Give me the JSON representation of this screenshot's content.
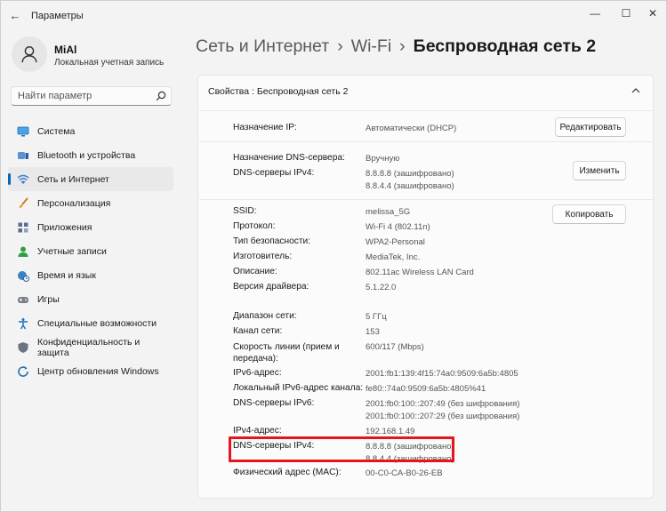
{
  "window": {
    "back_glyph": "←",
    "title": "Параметры",
    "minimize_glyph": "—",
    "maximize_glyph": "☐",
    "close_glyph": "✕"
  },
  "user": {
    "name": "MiAl",
    "account_type": "Локальная учетная запись"
  },
  "search": {
    "placeholder": "Найти параметр"
  },
  "sidebar": {
    "items": [
      {
        "label": "Система",
        "icon": "monitor-icon",
        "active": false
      },
      {
        "label": "Bluetooth и устройства",
        "icon": "bluetooth-devices-icon",
        "active": false
      },
      {
        "label": "Сеть и Интернет",
        "icon": "wifi-network-icon",
        "active": true
      },
      {
        "label": "Персонализация",
        "icon": "brush-icon",
        "active": false
      },
      {
        "label": "Приложения",
        "icon": "apps-icon",
        "active": false
      },
      {
        "label": "Учетные записи",
        "icon": "account-icon",
        "active": false
      },
      {
        "label": "Время и язык",
        "icon": "globe-clock-icon",
        "active": false
      },
      {
        "label": "Игры",
        "icon": "gamepad-icon",
        "active": false
      },
      {
        "label": "Специальные возможности",
        "icon": "accessibility-icon",
        "active": false
      },
      {
        "label": "Конфиденциальность и защита",
        "icon": "shield-icon",
        "active": false
      },
      {
        "label": "Центр обновления Windows",
        "icon": "update-icon",
        "active": false
      }
    ],
    "accent_color": "#0067c0"
  },
  "breadcrumb": {
    "items": [
      "Сеть и Интернет",
      "Wi-Fi"
    ],
    "separator": "›",
    "current": "Беспроводная сеть 2"
  },
  "panel": {
    "header": "Свойства : Беспроводная сеть 2",
    "ip_assignment": {
      "label": "Назначение IP:",
      "value": "Автоматически (DHCP)",
      "button": "Редактировать"
    },
    "dns_assignment": {
      "label": "Назначение DNS-сервера:",
      "value": "Вручную"
    },
    "dns_ipv4_top": {
      "label": "DNS-серверы IPv4:",
      "value1": "8.8.8.8 (зашифровано)",
      "value2": "8.8.4.4 (зашифровано)",
      "button": "Изменить"
    },
    "copy_button": "Копировать",
    "props": {
      "ssid": {
        "label": "SSID:",
        "value": "melissa_5G"
      },
      "protocol": {
        "label": "Протокол:",
        "value": "Wi-Fi 4 (802.11n)"
      },
      "security": {
        "label": "Тип безопасности:",
        "value": "WPA2-Personal"
      },
      "manufacturer": {
        "label": "Изготовитель:",
        "value": "MediaTek, Inc."
      },
      "description": {
        "label": "Описание:",
        "value": "802.11ac Wireless LAN Card"
      },
      "driver": {
        "label": "Версия драйвера:",
        "value": "5.1.22.0"
      },
      "band": {
        "label": "Диапазон сети:",
        "value": "5 ГГц"
      },
      "channel": {
        "label": "Канал сети:",
        "value": "153"
      },
      "link_speed": {
        "label": "Скорость линии (прием и передача):",
        "value": "600/117 (Mbps)"
      },
      "ipv6": {
        "label": "IPv6-адрес:",
        "value": "2001:fb1:139:4f15:74a0:9509:6a5b:4805"
      },
      "ipv6_local": {
        "label": "Локальный IPv6-адрес канала:",
        "value": "fe80::74a0:9509:6a5b:4805%41"
      },
      "dns_ipv6": {
        "label": "DNS-серверы IPv6:",
        "value1": "2001:fb0:100::207:49 (без шифрования)",
        "value2": "2001:fb0:100::207:29 (без шифрования)"
      },
      "ipv4": {
        "label": "IPv4-адрес:",
        "value": "192.168.1.49"
      },
      "dns_ipv4": {
        "label": "DNS-серверы IPv4:",
        "value1": "8.8.8.8 (зашифровано)",
        "value2": "8.8.4.4 (зашифровано)"
      },
      "mac": {
        "label": "Физический адрес (MAC):",
        "value": "00-C0-CA-B0-26-EB"
      }
    },
    "highlight_color": "#e8141c"
  }
}
